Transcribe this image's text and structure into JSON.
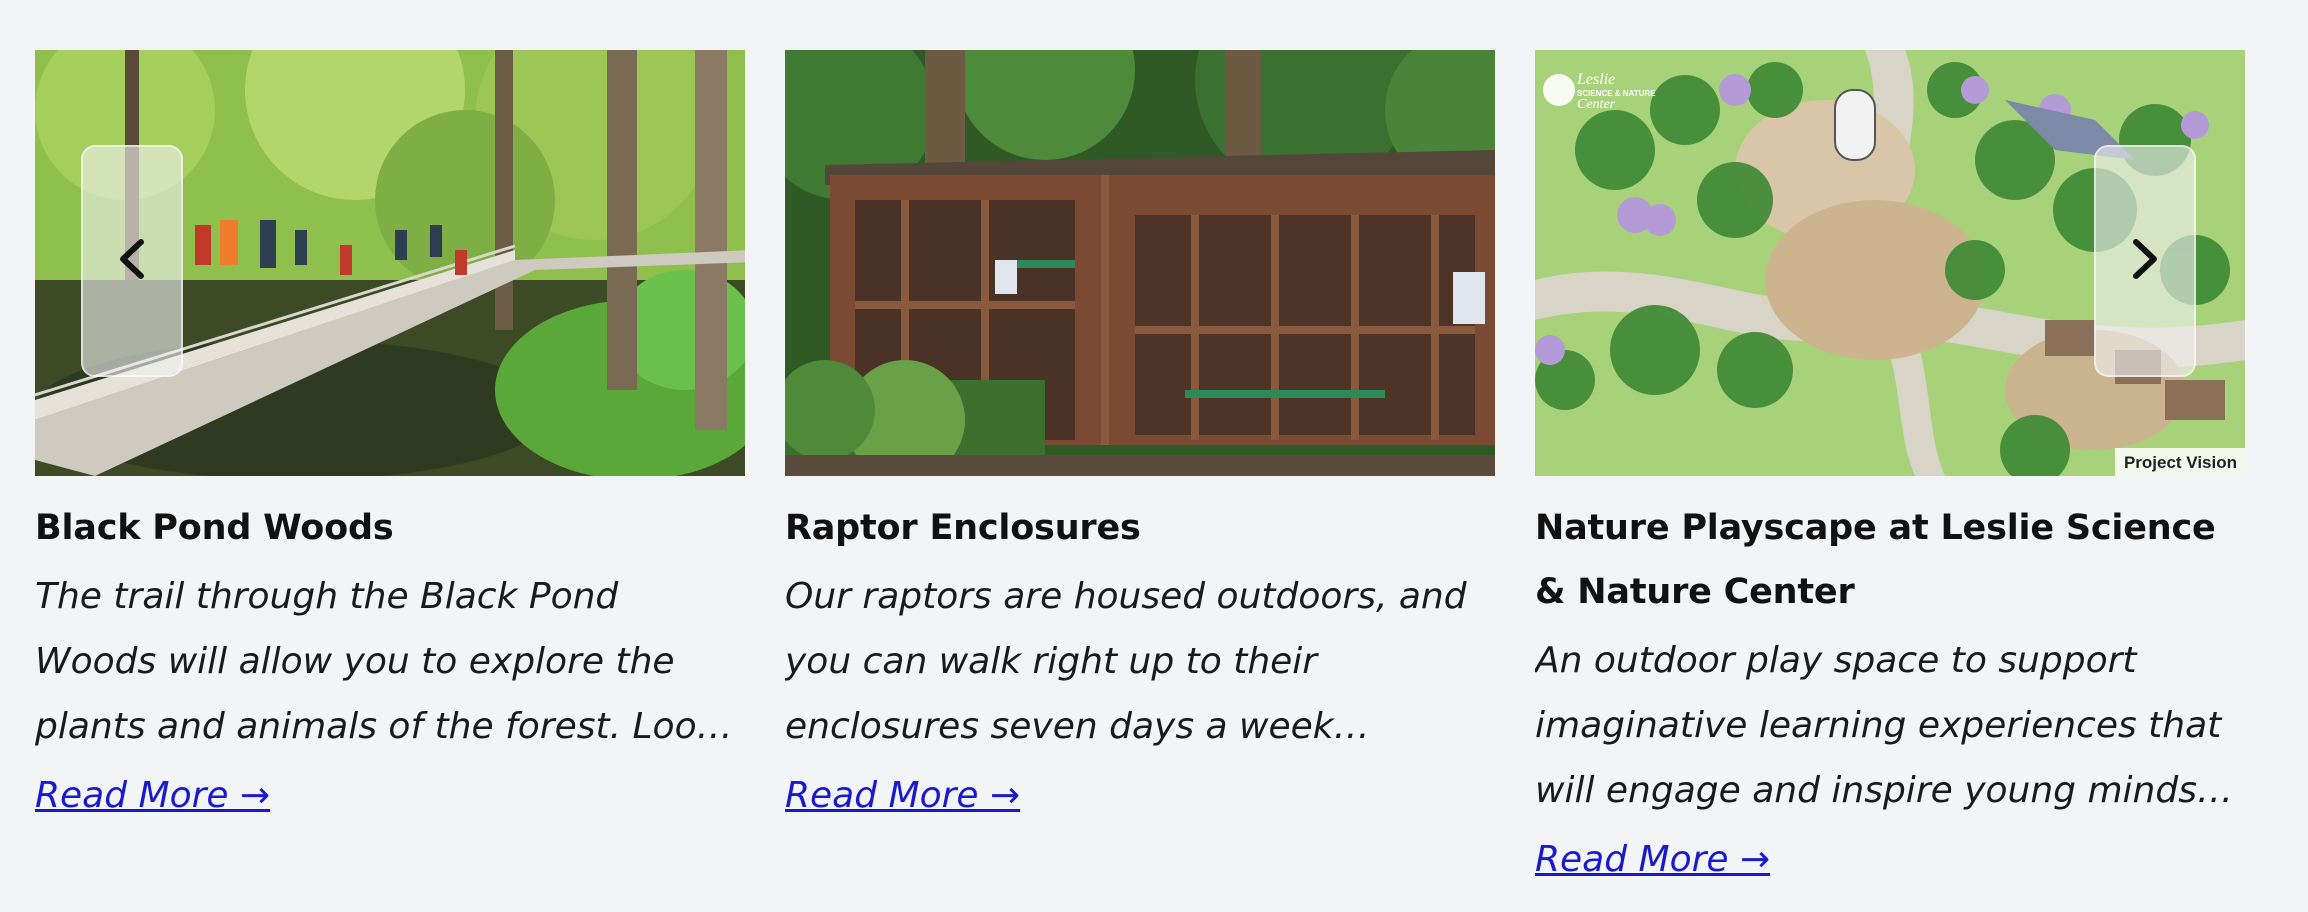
{
  "carousel": {
    "prev_icon": "chevron-left-icon",
    "next_icon": "chevron-right-icon",
    "cards": [
      {
        "image_alt": "Black Pond Woods boardwalk",
        "title": "Black Pond Woods",
        "description": "The trail through the Black Pond Woods will allow you to explore the plants and animals of the forest. Look for nests,…",
        "link": "Read More →"
      },
      {
        "image_alt": "Raptor Enclosures",
        "title": "Raptor Enclosures",
        "description": "Our raptors are housed outdoors, and you can walk right up to their enclosures seven days a week during…",
        "link": "Read More →"
      },
      {
        "image_alt": "Nature Playscape plan",
        "title": "Nature Playscape at Leslie Science & Nature Center",
        "description": "An outdoor play space to support imaginative learning experiences that will engage and inspire young minds t…",
        "link": "Read More →",
        "image_text": {
          "logo_line1": "Leslie",
          "logo_line2": "SCIENCE & NATURE",
          "logo_line3": "Center",
          "caption": "Project Vision"
        }
      }
    ]
  }
}
